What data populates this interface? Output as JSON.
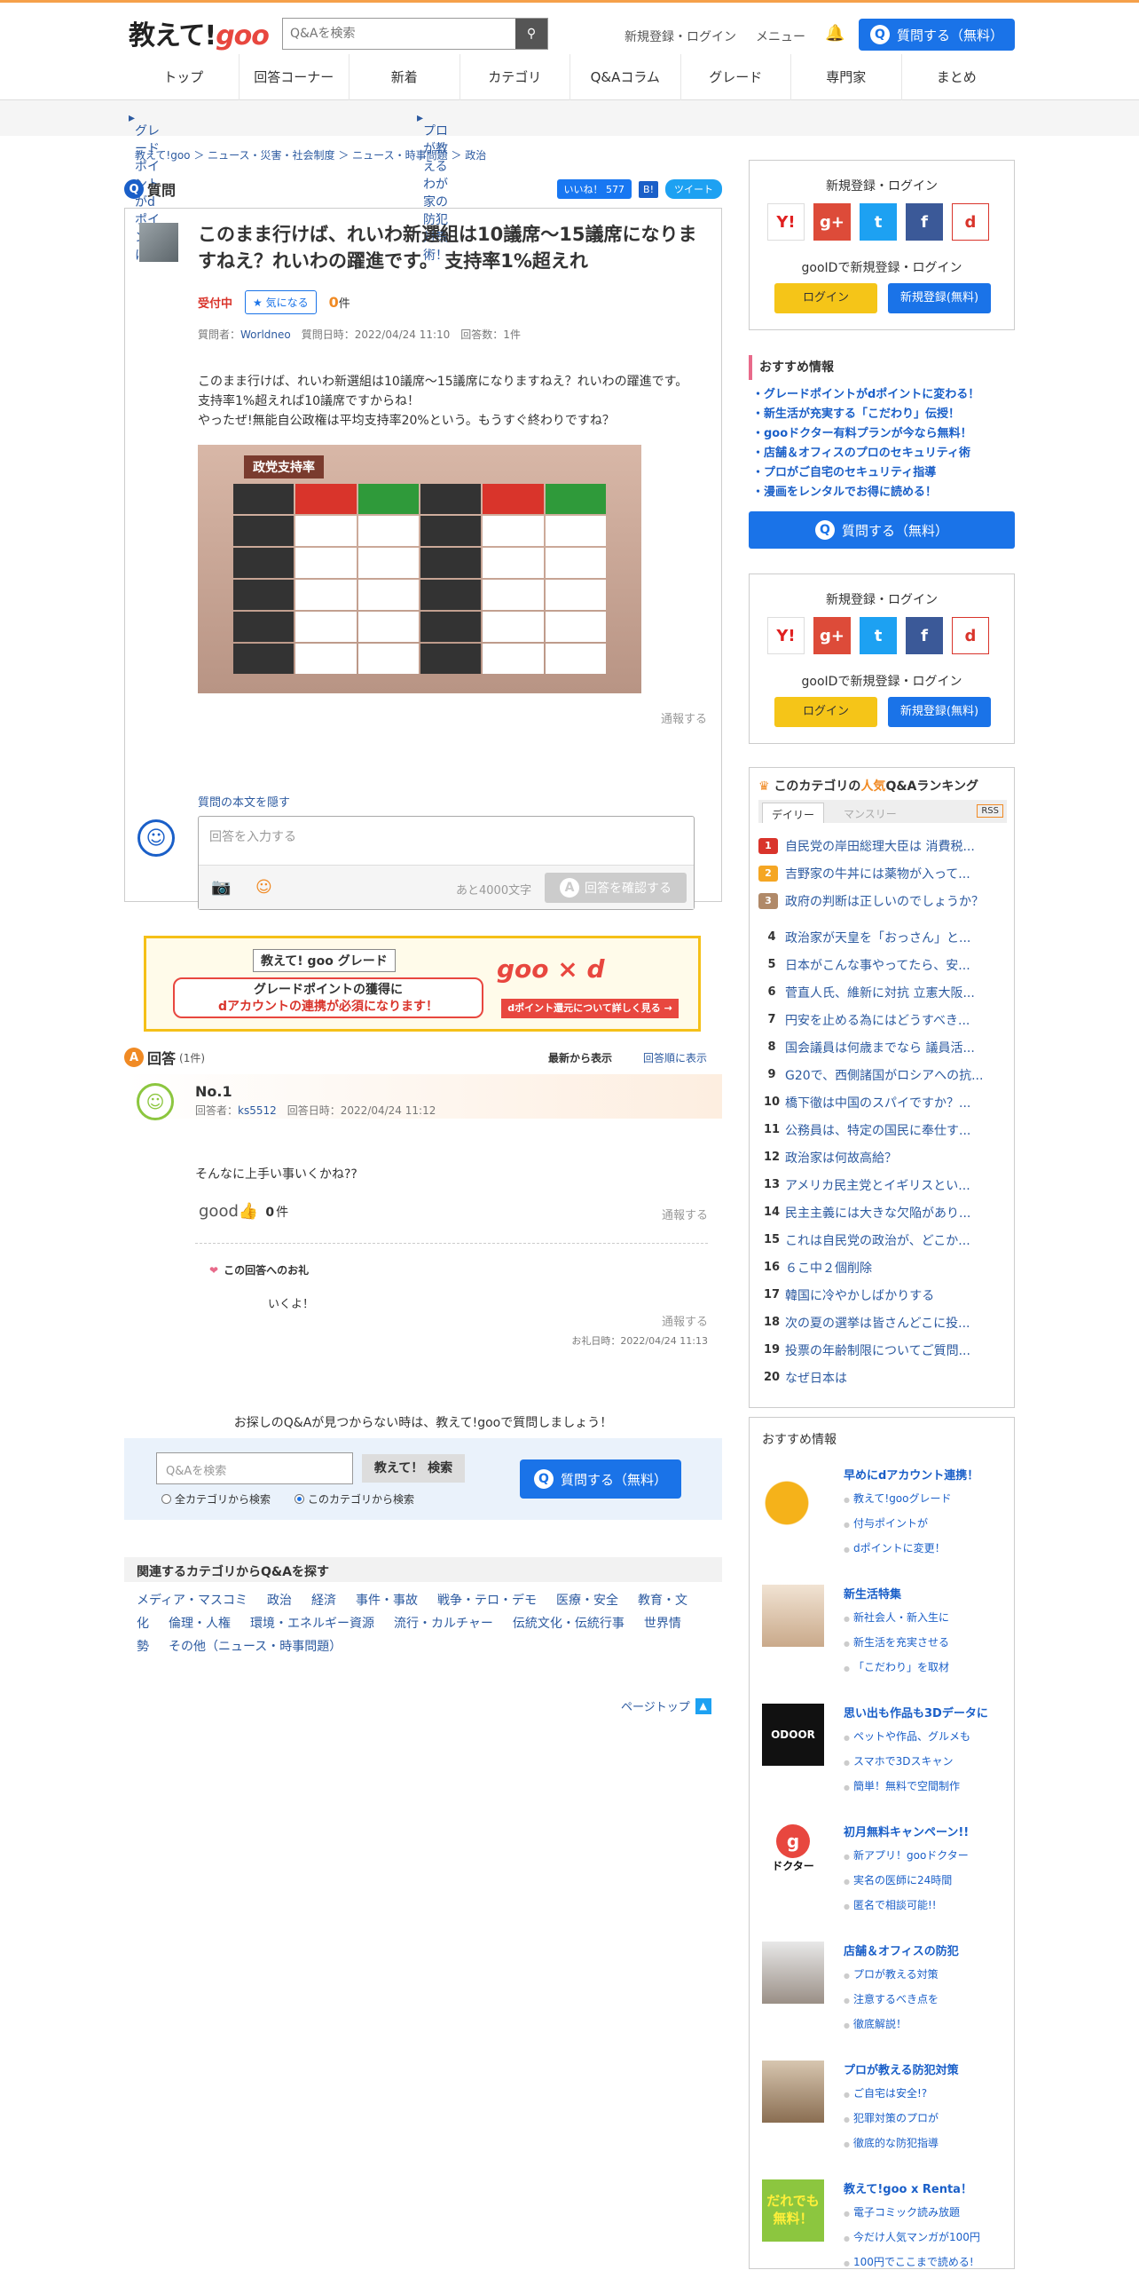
{
  "header": {
    "logo_text": "教えて!",
    "logo_goo": "goo",
    "search_placeholder": "Q&Aを検索",
    "register": "新規登録・ログイン",
    "menu": "メニュー",
    "ask": "質問する（無料）"
  },
  "nav": [
    "トップ",
    "回答コーナー",
    "新着",
    "カテゴリ",
    "Q&Aコラム",
    "グレード",
    "専門家",
    "まとめ"
  ],
  "promo": [
    "グレードポイントがdポイントに！",
    "プロが教えるわが家の防犯対策術！"
  ],
  "breadcrumb": "教えて!goo ＞ ニュース・災害・社会制度 ＞ ニュース・時事問題 ＞ 政治",
  "question": {
    "section": "質問",
    "like": "いいね！ 577",
    "bookmark": "B!",
    "tweet": "ツイート",
    "title": "このまま行けば、れいわ新選組は10議席～15議席になりますねえ？れいわの躍進です。 支持率1%超えれ",
    "status": "受付中",
    "watch": "気になる",
    "watch_count": "0",
    "watch_unit": "件",
    "meta": "質問者：",
    "user": "Worldneo",
    "meta2": "質問日時：2022/04/24 11:10　回答数：1件",
    "body": "このまま行けば、れいわ新選組は10議席～15議席になりますねえ？れいわの躍進です。\n支持率1%超えれば10議席ですからね！\nやったぜ!無能自公政権は平均支持率20%という。もうすぐ終わりですね？",
    "image_title": "政党支持率",
    "report": "通報する",
    "quote": "質問の本文を隠す",
    "answer_placeholder": "回答を入力する",
    "remaining": "あと4000文字",
    "confirm": "回答を確認する"
  },
  "banner": {
    "label": "教えて! goo グレード",
    "line1": "グレードポイントの獲得に",
    "line2": "dアカウントの連携が必須になります！",
    "brand": "goo × d",
    "cta": "dポイント還元について詳しく見る →"
  },
  "answers": {
    "section": "回答",
    "count": "(1件)",
    "sort_new": "最新から表示",
    "sort_old": "回答順に表示",
    "items": [
      {
        "no": "No.1",
        "meta": "回答者：",
        "user": "ks5512",
        "date": "回答日時：2022/04/24 11:12",
        "text": "そんなに上手い事いくかね??",
        "good": "good",
        "good_count": "0",
        "good_unit": "件",
        "report": "通報する",
        "thanks_head": "この回答へのお礼",
        "thanks": "いくよ！",
        "thanks_report": "通報する",
        "thanks_date": "お礼日時：2022/04/24 11:13"
      }
    ]
  },
  "notfound": "お探しのQ&Aが見つからない時は、教えて!gooで質問しましょう！",
  "bottom_search": {
    "placeholder": "Q&Aを検索",
    "button": "教えて！ 検索",
    "radio1": "全カテゴリから検索",
    "radio2": "このカテゴリから検索",
    "ask": "質問する（無料）"
  },
  "related": {
    "title": "関連するカテゴリからQ&Aを探す",
    "cats": [
      "メディア・マスコミ",
      "政治",
      "経済",
      "事件・事故",
      "戦争・テロ・デモ",
      "医療・安全",
      "教育・文化",
      "倫理・人権",
      "環境・エネルギー資源",
      "流行・カルチャー",
      "伝統文化・伝統行事",
      "世界情勢",
      "その他（ニュース・時事問題）"
    ]
  },
  "pagetop": "ページトップ",
  "sidebar": {
    "login_title": "新規登録・ログイン",
    "gooid": "gooIDで新規登録・ログイン",
    "login": "ログイン",
    "register": "新規登録(無料)",
    "rec_title": "おすすめ情報",
    "rec": [
      "・グレードポイントがdポイントに変わる！",
      "・新生活が充実する「こだわり」伝授！",
      "・gooドクター有料プランが今なら無料！",
      "・店舗＆オフィスのプロのセキュリティ術",
      "・プロがご自宅のセキュリティ指導",
      "・漫画をレンタルでお得に読める！"
    ],
    "ask": "質問する（無料）",
    "rank_title_pre": "このカテゴリの",
    "rank_title_hl": "人気",
    "rank_title_post": "Q&Aランキング",
    "tab_daily": "デイリー",
    "tab_monthly": "マンスリー",
    "rss": "RSS",
    "ranking": [
      "自民党の岸田総理大臣は 消費税...",
      "吉野家の牛丼には薬物が入って...",
      "政府の判断は正しいのでしょうか？",
      "政治家が天皇を「おっさん」と...",
      "日本がこんな事やってたら、安...",
      "菅直人氏、維新に対抗 立憲大阪...",
      "円安を止める為にはどうすべき...",
      "国会議員は何歳までなら 議員活...",
      "G20で、西側諸国がロシアへの抗...",
      "橋下徹は中国のスパイですか？...",
      "公務員は、特定の国民に奉仕す...",
      "政治家は何故高給？",
      "アメリカ民主党とイギリスとい...",
      "民主主義には大きな欠陥があり...",
      "これは自民党の政治が、どこか...",
      "６こ中２個削除",
      "韓国に冷やかしばかりする",
      "次の夏の選挙は皆さんどこに投...",
      "投票の年齢制限についてご質問...",
      "なぜ日本は"
    ],
    "osusume_title": "おすすめ情報",
    "cards": [
      {
        "title": "早めにdアカウント連携！",
        "items": [
          "教えて!gooグレード",
          "付与ポイントが",
          "dポイントに変更！"
        ]
      },
      {
        "title": "新生活特集",
        "items": [
          "新社会人・新入生に",
          "新生活を充実させる",
          "「こだわり」を取材"
        ]
      },
      {
        "title": "思い出も作品も3Dデータに",
        "items": [
          "ペットや作品、グルメも",
          "スマホで3Dスキャン",
          "簡単！無料で空間制作"
        ]
      },
      {
        "title": "初月無料キャンペーン!!",
        "items": [
          "新アプリ！gooドクター",
          "実名の医師に24時間",
          "匿名で相談可能!!"
        ]
      },
      {
        "title": "店舗＆オフィスの防犯",
        "items": [
          "プロが教える対策",
          "注意するべき点を",
          "徹底解説！"
        ]
      },
      {
        "title": "プロが教える防犯対策",
        "items": [
          "ご自宅は安全!?",
          "犯罪対策のプロが",
          "徹底的な防犯指導"
        ]
      },
      {
        "title": "教えて!goo x Renta！",
        "items": [
          "電子コミック読み放題",
          "今だけ人気マンガが100円",
          "100円でここまで読める!"
        ]
      }
    ],
    "thumb_odoor": "ODOOR",
    "thumb_doctor": "ドクター",
    "thumb_renta": "だれでも無料！"
  },
  "colors": {
    "accent": "#1a73e8",
    "orange": "#f08a24",
    "red": "#d9342b"
  }
}
